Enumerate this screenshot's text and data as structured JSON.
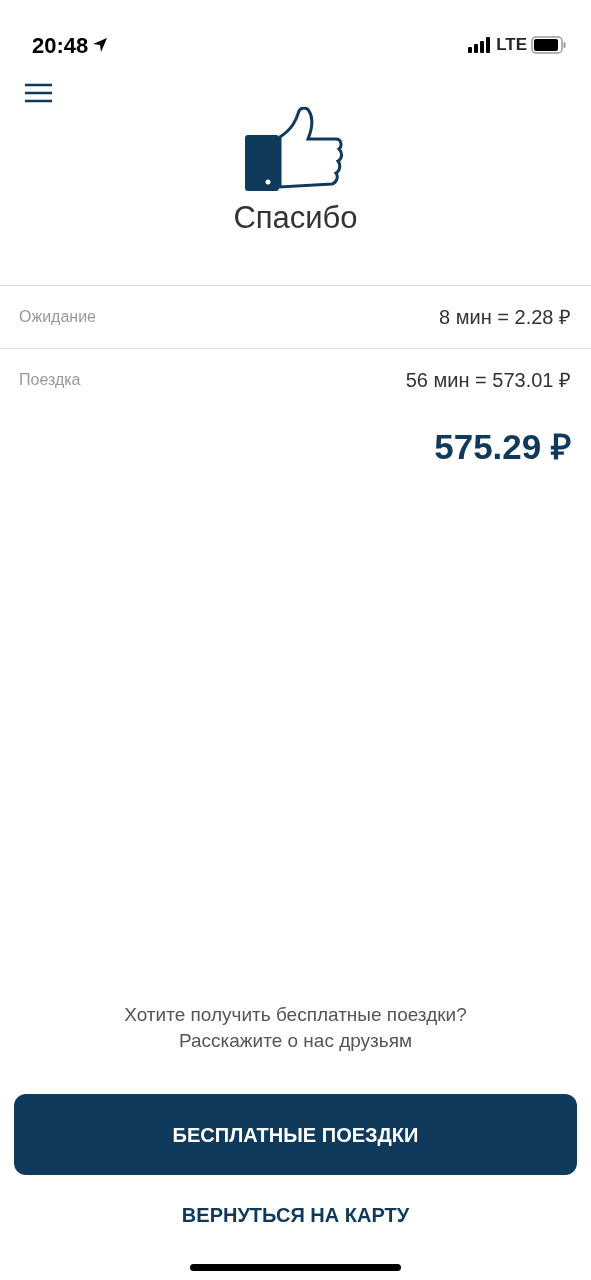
{
  "status_bar": {
    "time": "20:48",
    "network": "LTE"
  },
  "title": "Спасибо",
  "charges": [
    {
      "label": "Ожидание",
      "value": "8 мин = 2.28 ₽"
    },
    {
      "label": "Поездка",
      "value": "56 мин = 573.01 ₽"
    }
  ],
  "total": "575.29 ₽",
  "promo": [
    "Хотите получить бесплатные поездки?",
    "Расскажите о нас друзьям"
  ],
  "primary_button": "БЕСПЛАТНЫЕ ПОЕЗДКИ",
  "secondary_button": "ВЕРНУТЬСЯ НА КАРТУ"
}
